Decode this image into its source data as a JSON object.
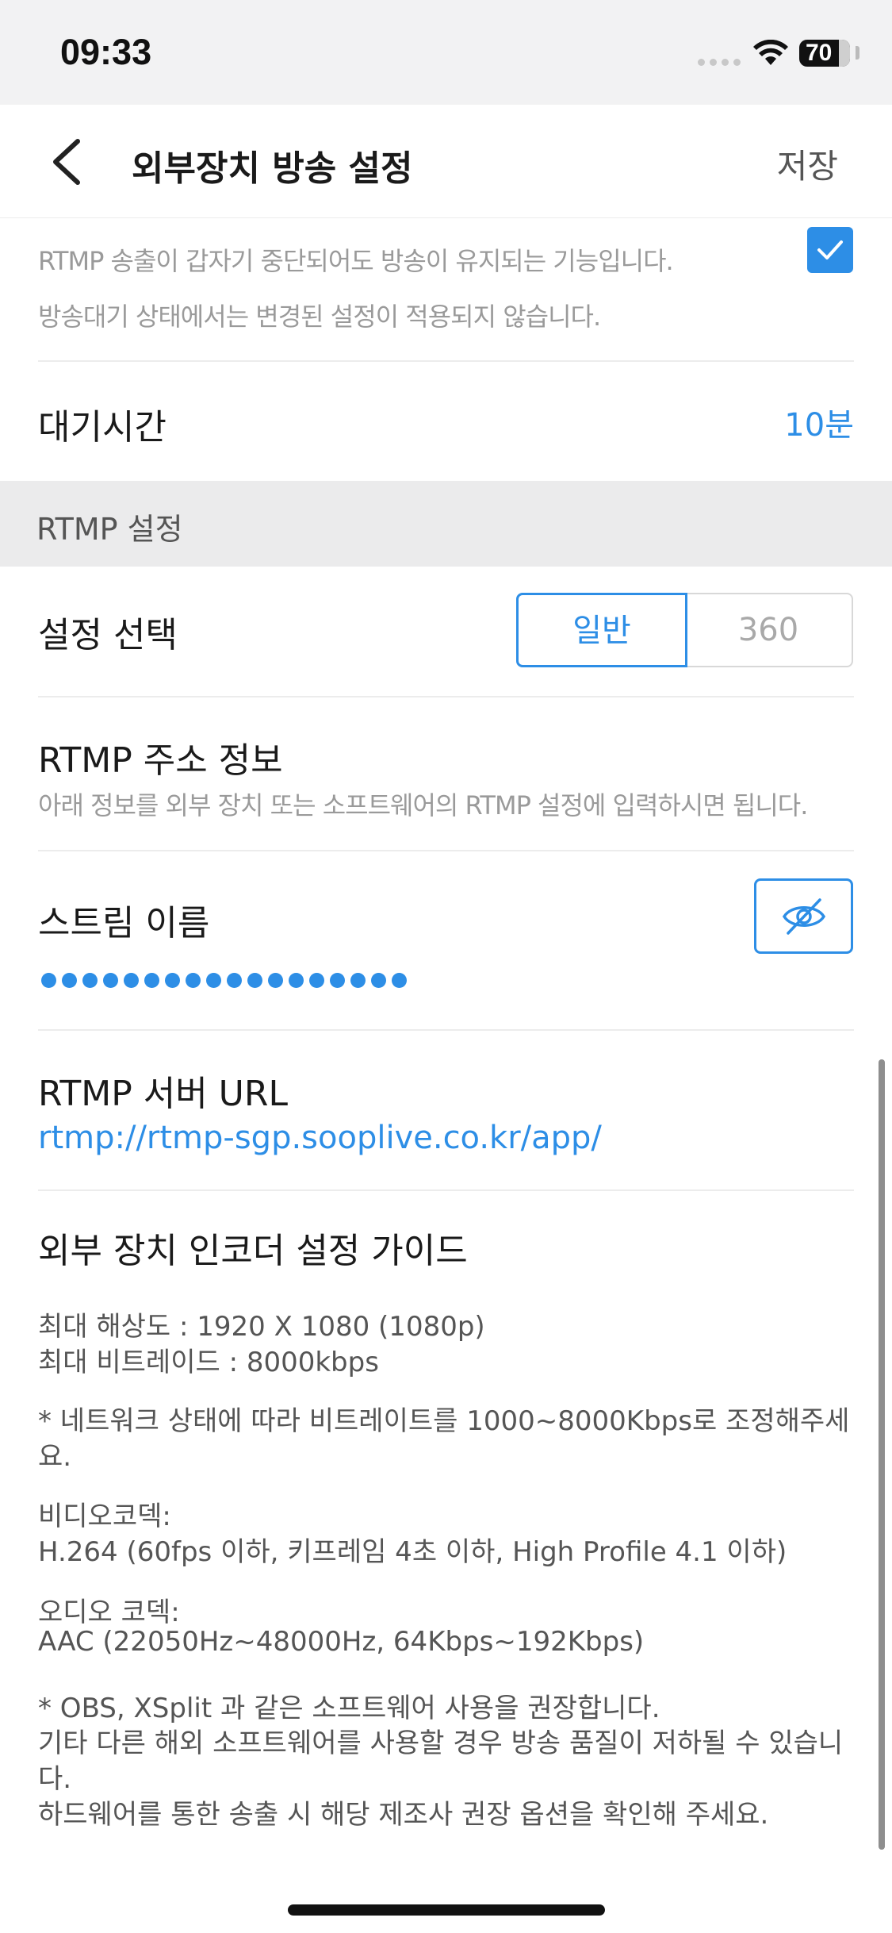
{
  "status_bar": {
    "time": "09:33",
    "battery": "70"
  },
  "nav": {
    "title": "외부장치 방송 설정",
    "save_label": "저장"
  },
  "keep_broadcast": {
    "desc_line1": "RTMP 송출이 갑자기 중단되어도 방송이 유지되는 기능입니다.",
    "desc_line2": "방송대기 상태에서는 변경된 설정이 적용되지 않습니다.",
    "checked": true
  },
  "wait_time": {
    "label": "대기시간",
    "value": "10분"
  },
  "rtmp_section": {
    "header": "RTMP 설정"
  },
  "setting_select": {
    "label": "설정 선택",
    "options": [
      "일반",
      "360"
    ],
    "selected": "일반"
  },
  "rtmp_address": {
    "title": "RTMP 주소 정보",
    "desc": "아래 정보를 외부 장치 또는 소프트웨어의 RTMP 설정에 입력하시면 됩니다."
  },
  "stream_name": {
    "label": "스트림 이름",
    "masked_length": 18
  },
  "server_url": {
    "label": "RTMP 서버 URL",
    "value": "rtmp://rtmp-sgp.sooplive.co.kr/app/"
  },
  "guide": {
    "title": "외부 장치 인코더 설정 가이드",
    "lines": [
      "최대 해상도 : 1920 X 1080 (1080p)",
      "최대 비트레이드 : 8000kbps",
      "* 네트워크 상태에 따라 비트레이트를 1000~8000Kbps로 조정해주세",
      "요.",
      "비디오코덱:",
      "H.264 (60fps 이하, 키프레임 4초 이하, High Profile 4.1 이하)",
      "오디오 코덱:",
      "AAC (22050Hz~48000Hz, 64Kbps~192Kbps)",
      "* OBS, XSplit 과 같은 소프트웨어 사용을 권장합니다.",
      "기타 다른 해외 소프트웨어를 사용할 경우 방송 품질이 저하될 수 있습니",
      "다.",
      "하드웨어를 통한 송출 시 해당 제조사 권장 옵션을 확인해 주세요."
    ]
  },
  "colors": {
    "accent": "#2d8ee6",
    "section_bg": "#ebebec",
    "muted_text": "#9a9a9a"
  },
  "icons": [
    "back-chevron-icon",
    "wifi-icon",
    "battery-icon",
    "check-icon",
    "eye-off-icon"
  ]
}
